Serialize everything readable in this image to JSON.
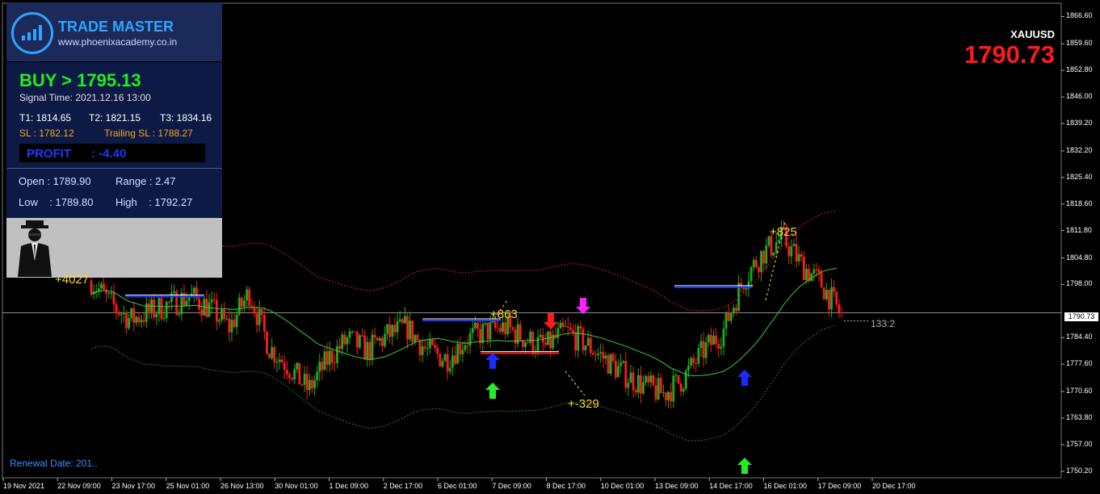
{
  "symbol": "XAUUSD",
  "price": "1790.73",
  "current_price_label": "1790.73",
  "panel": {
    "brand": "TRADE MASTER",
    "site": "www.phoenixacademy.co.in",
    "signal": "BUY > 1795.13",
    "signal_time": "Signal Time: 2021.12.16 13:00",
    "t1": "T1: 1814.65",
    "t2": "T2: 1821.15",
    "t3": "T3: 1834.16",
    "sl": "SL : 1782.12",
    "trailing_sl": "Trailing SL : 1788.27",
    "profit": "PROFIT      : -4.40",
    "open": "Open : 1789.90",
    "range": "Range : 2.47",
    "low": "Low    : 1789.80",
    "high": "High    : 1792.27"
  },
  "renewal": "Renewal Date: 201..",
  "annotations": {
    "a1": "+4027",
    "a2": "+863",
    "a3": "+-329",
    "a4": "+825",
    "ratio": "133:2"
  },
  "y_axis": [
    "1866.60",
    "1859.60",
    "1852.80",
    "1846.00",
    "1839.20",
    "1832.20",
    "1825.40",
    "1818.60",
    "1811.80",
    "1804.80",
    "1798.00",
    "1784.40",
    "1777.60",
    "1770.60",
    "1763.80",
    "1757.00",
    "1750.20"
  ],
  "x_axis": [
    "19 Nov 2021",
    "22 Nov 09:00",
    "23 Nov 17:00",
    "25 Nov 01:00",
    "26 Nov 13:00",
    "30 Nov 01:00",
    "1 Dec 09:00",
    "2 Dec 17:00",
    "6 Dec 01:00",
    "7 Dec 09:00",
    "8 Dec 17:00",
    "10 Dec 01:00",
    "13 Dec 09:00",
    "14 Dec 17:00",
    "16 Dec 01:00",
    "17 Dec 09:00",
    "20 Dec 17:00"
  ],
  "colors": {
    "bull": "#22aa22",
    "bear": "#ff1a1a",
    "upper_band": "#cc2020",
    "lower_band": "#1a8a1a",
    "midline": "#3ccc3c",
    "entry_line": "#1a3cff"
  },
  "chart_data": {
    "type": "candlestick",
    "symbol": "XAUUSD",
    "ylim": [
      1748.5,
      1870
    ],
    "x": [
      "19 Nov 2021",
      "22 Nov 09:00",
      "23 Nov 17:00",
      "25 Nov 01:00",
      "26 Nov 13:00",
      "30 Nov 01:00",
      "1 Dec 09:00",
      "2 Dec 17:00",
      "6 Dec 01:00",
      "7 Dec 09:00",
      "8 Dec 17:00",
      "10 Dec 01:00",
      "13 Dec 09:00",
      "14 Dec 17:00",
      "16 Dec 01:00",
      "17 Dec 09:00",
      "20 Dec 17:00"
    ],
    "close_path": [
      1799,
      1793,
      1789,
      1791,
      1793,
      1795,
      1792,
      1787,
      1796,
      1782,
      1777,
      1771,
      1779,
      1784,
      1781,
      1785,
      1787,
      1781,
      1779,
      1784,
      1786,
      1787,
      1784,
      1782,
      1786,
      1783,
      1779,
      1775,
      1772,
      1770,
      1774,
      1781,
      1786,
      1799,
      1806,
      1810,
      1803,
      1798,
      1790
    ],
    "last": 1790.73
  }
}
